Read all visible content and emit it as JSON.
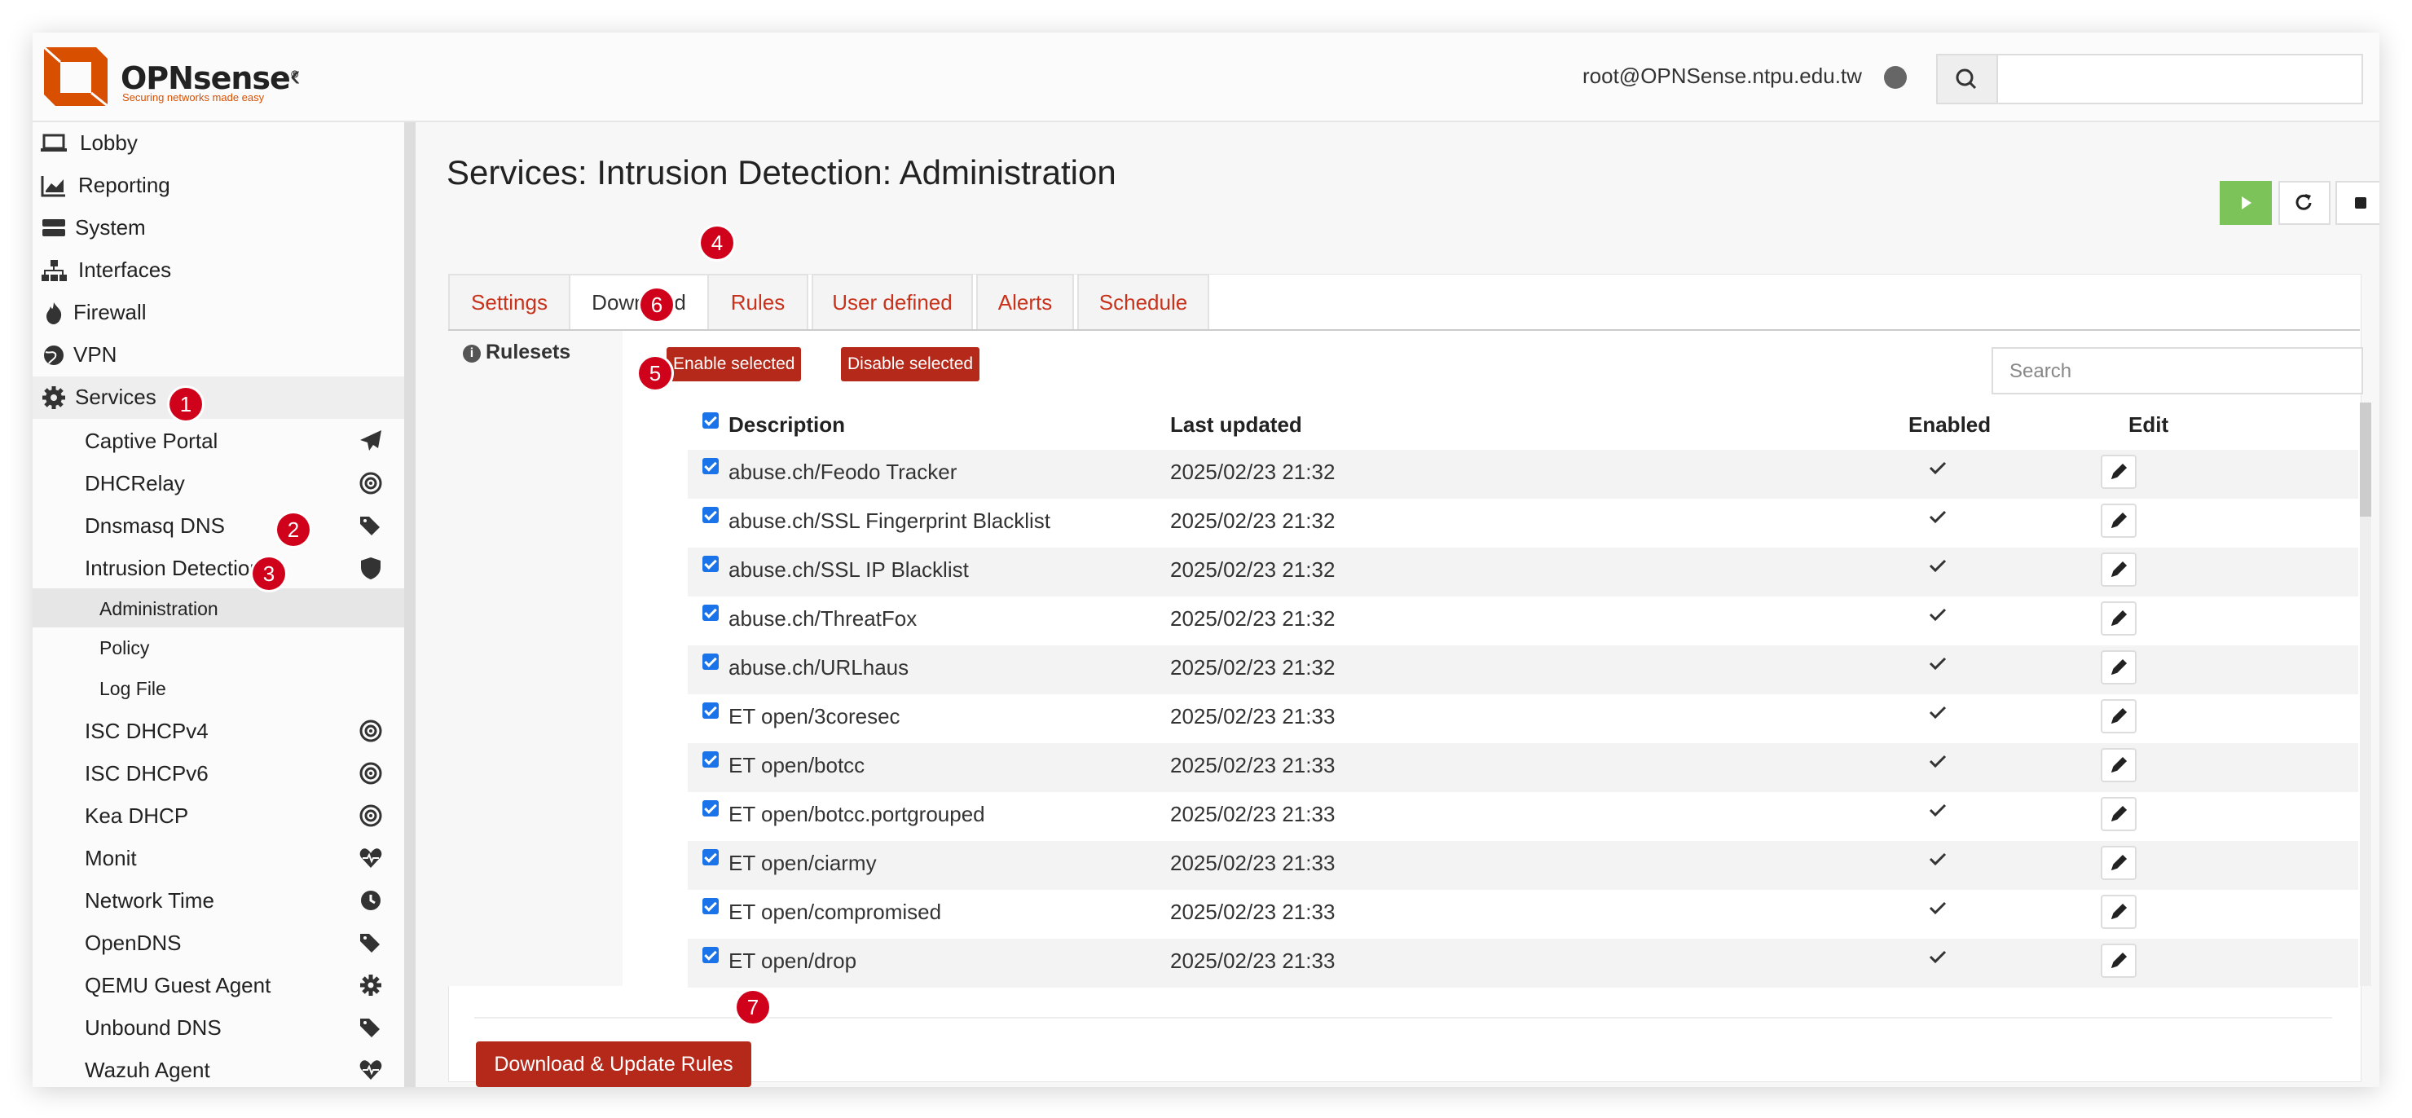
{
  "brand": {
    "name": "OPNsense",
    "trademark": "®",
    "tagline": "Securing networks made easy"
  },
  "header": {
    "user": "root@OPNSense.ntpu.edu.tw",
    "search_placeholder": ""
  },
  "sidebar": {
    "items": [
      {
        "label": "Lobby",
        "icon": "laptop-icon"
      },
      {
        "label": "Reporting",
        "icon": "chart-icon"
      },
      {
        "label": "System",
        "icon": "server-icon"
      },
      {
        "label": "Interfaces",
        "icon": "sitemap-icon"
      },
      {
        "label": "Firewall",
        "icon": "fire-icon"
      },
      {
        "label": "VPN",
        "icon": "globe-icon"
      },
      {
        "label": "Services",
        "icon": "gear-icon"
      }
    ],
    "services_children": [
      {
        "label": "Captive Portal",
        "icon": "paper-plane-icon"
      },
      {
        "label": "DHCRelay",
        "icon": "bullseye-icon"
      },
      {
        "label": "Dnsmasq DNS",
        "icon": "tags-icon"
      },
      {
        "label": "Intrusion Detection",
        "icon": "shield-icon"
      }
    ],
    "ids_children": [
      {
        "label": "Administration"
      },
      {
        "label": "Policy"
      },
      {
        "label": "Log File"
      }
    ],
    "more_services": [
      {
        "label": "ISC DHCPv4",
        "icon": "bullseye-icon"
      },
      {
        "label": "ISC DHCPv6",
        "icon": "bullseye-icon"
      },
      {
        "label": "Kea DHCP",
        "icon": "bullseye-icon"
      },
      {
        "label": "Monit",
        "icon": "heartbeat-icon"
      },
      {
        "label": "Network Time",
        "icon": "clock-icon"
      },
      {
        "label": "OpenDNS",
        "icon": "tags-icon"
      },
      {
        "label": "QEMU Guest Agent",
        "icon": "gear-icon"
      },
      {
        "label": "Unbound DNS",
        "icon": "tags-icon"
      },
      {
        "label": "Wazuh Agent",
        "icon": "heartbeat-icon"
      }
    ]
  },
  "page": {
    "title": "Services: Intrusion Detection: Administration"
  },
  "tabs": [
    "Settings",
    "Download",
    "Rules",
    "User defined",
    "Alerts",
    "Schedule"
  ],
  "active_tab": "Download",
  "rulesets_label": "Rulesets",
  "actions": {
    "enable_selected": "Enable selected",
    "disable_selected": "Disable selected"
  },
  "grid": {
    "search_placeholder": "Search",
    "columns": [
      "Description",
      "Last updated",
      "Enabled",
      "Edit"
    ],
    "rows": [
      {
        "description": "abuse.ch/Feodo Tracker",
        "last_updated": "2025/02/23 21:32"
      },
      {
        "description": "abuse.ch/SSL Fingerprint Blacklist",
        "last_updated": "2025/02/23 21:32"
      },
      {
        "description": "abuse.ch/SSL IP Blacklist",
        "last_updated": "2025/02/23 21:32"
      },
      {
        "description": "abuse.ch/ThreatFox",
        "last_updated": "2025/02/23 21:32"
      },
      {
        "description": "abuse.ch/URLhaus",
        "last_updated": "2025/02/23 21:32"
      },
      {
        "description": "ET open/3coresec",
        "last_updated": "2025/02/23 21:33"
      },
      {
        "description": "ET open/botcc",
        "last_updated": "2025/02/23 21:33"
      },
      {
        "description": "ET open/botcc.portgrouped",
        "last_updated": "2025/02/23 21:33"
      },
      {
        "description": "ET open/ciarmy",
        "last_updated": "2025/02/23 21:33"
      },
      {
        "description": "ET open/compromised",
        "last_updated": "2025/02/23 21:33"
      },
      {
        "description": "ET open/drop",
        "last_updated": "2025/02/23 21:33"
      }
    ]
  },
  "download_button": "Download & Update Rules",
  "badges": [
    "1",
    "2",
    "3",
    "4",
    "5",
    "6",
    "7"
  ],
  "colors": {
    "accent": "#c8321b",
    "button_red": "#b5291a",
    "play_green": "#7cc35a",
    "badge": "#d0021b"
  }
}
